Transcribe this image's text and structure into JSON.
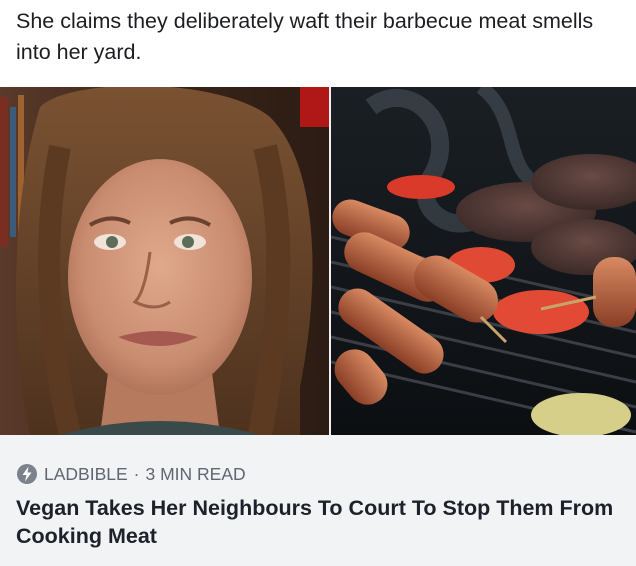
{
  "post": {
    "text": "She claims they deliberately waft their barbecue meat smells into her yard."
  },
  "link_card": {
    "images": [
      {
        "name": "interview-woman-photo"
      },
      {
        "name": "barbecue-grill-photo"
      }
    ],
    "source_icon": "lightning-bolt-icon",
    "source": "LADBIBLE",
    "separator": "·",
    "read_time": "3 MIN READ",
    "headline": "Vegan Takes Her Neighbours To Court To Stop Them From Cooking Meat"
  },
  "colors": {
    "card_background": "#f2f3f5",
    "meta_text": "#606770",
    "headline_text": "#1d2129"
  }
}
